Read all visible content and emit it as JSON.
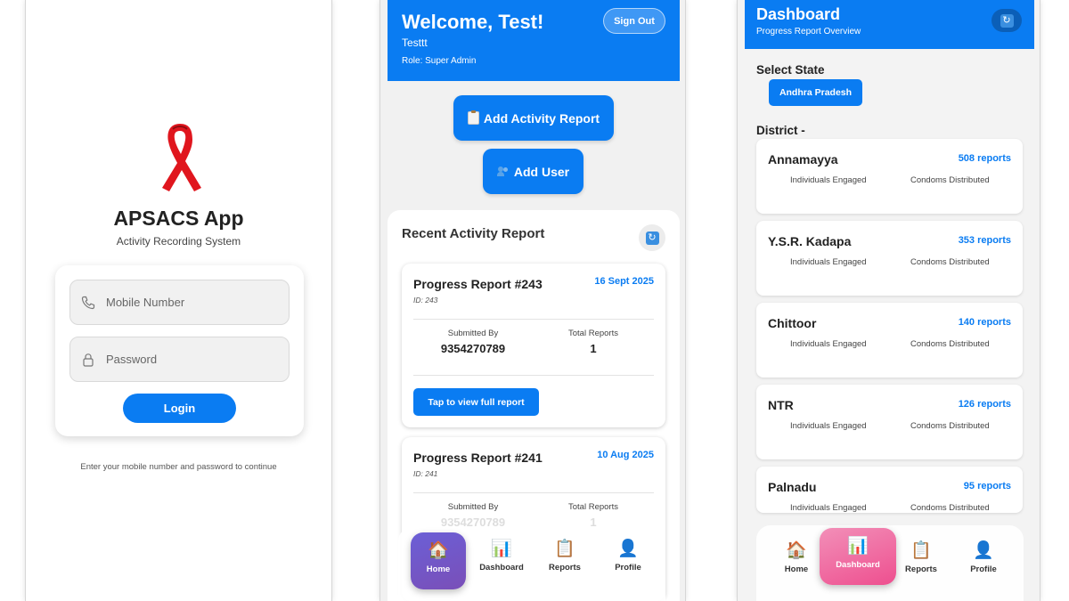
{
  "login": {
    "app_title": "APSACS App",
    "subtitle": "Activity Recording System",
    "mobile_placeholder": "Mobile Number",
    "password_placeholder": "Password",
    "login_label": "Login",
    "hint": "Enter your mobile number and password to continue"
  },
  "home": {
    "welcome": "Welcome, Test!",
    "username": "Testtt",
    "role": "Role: Super Admin",
    "sign_out": "Sign Out",
    "add_activity_label": "Add Activity Report",
    "add_user_label": "Add User",
    "recent_title": "Recent Activity Report",
    "reports": [
      {
        "title": "Progress Report #243",
        "date": "16 Sept 2025",
        "id": "ID: 243",
        "submitted_by_label": "Submitted By",
        "submitted_by": "9354270789",
        "total_label": "Total Reports",
        "total": "1",
        "view_label": "Tap to view full report"
      },
      {
        "title": "Progress Report #241",
        "date": "10 Aug 2025",
        "id": "ID: 241",
        "submitted_by_label": "Submitted By",
        "submitted_by": "9354270789",
        "total_label": "Total Reports",
        "total": "1"
      }
    ]
  },
  "nav": {
    "home": "Home",
    "dashboard": "Dashboard",
    "reports": "Reports",
    "profile": "Profile"
  },
  "dashboard": {
    "title": "Dashboard",
    "subtitle": "Progress Report Overview",
    "select_state_label": "Select State",
    "state": "Andhra Pradesh",
    "district_label": "District -",
    "col1_label": "Individuals Engaged",
    "col2_label": "Condoms Distributed",
    "districts": [
      {
        "name": "Annamayya",
        "count": "508 reports"
      },
      {
        "name": "Y.S.R. Kadapa",
        "count": "353 reports"
      },
      {
        "name": "Chittoor",
        "count": "140 reports"
      },
      {
        "name": "NTR",
        "count": "126 reports"
      },
      {
        "name": "Palnadu",
        "count": "95 reports"
      }
    ]
  },
  "icons": {
    "ribbon": "red-ribbon-icon",
    "phone": "phone-icon",
    "lock": "lock-icon",
    "clipboard": "clipboard-icon",
    "users": "users-icon",
    "refresh": "refresh-icon",
    "home": "house-icon",
    "chart": "bar-chart-icon",
    "profile": "person-icon"
  },
  "colors": {
    "primary": "#0a7cf2",
    "ribbon_red": "#e0161e",
    "home_active_start": "#6b5fd6",
    "dash_active_start": "#f28fb8"
  }
}
